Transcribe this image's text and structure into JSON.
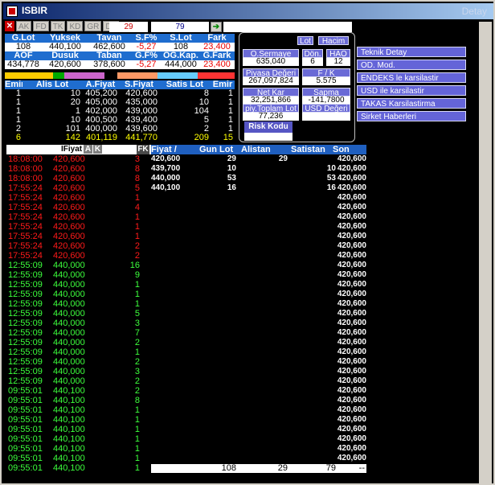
{
  "window": {
    "title": "ISBIR",
    "right_label": "Detay"
  },
  "toolbar": {
    "tabs": [
      "AK",
      "FD",
      "TK",
      "KD",
      "GR",
      "DK"
    ],
    "value_left": "29",
    "value_right": "79"
  },
  "stats": {
    "row1_headers": [
      "G.Lot",
      "Yuksek",
      "Tavan",
      "S.F%",
      "S.Lot",
      "Fark"
    ],
    "row1_values": [
      "108",
      "440,100",
      "462,600",
      "-5,27",
      "108",
      "23,400"
    ],
    "row2_headers": [
      "AOF",
      "Dusuk",
      "Taban",
      "G.F%",
      "OG.Kap.",
      "G.Fark"
    ],
    "row2_values": [
      "434,778",
      "420,600",
      "378,600",
      "-5,27",
      "444,000",
      "23,400"
    ]
  },
  "book": {
    "headers": [
      "Emir",
      "Alis Lot",
      "A.Fiyat",
      "S.Fiyat",
      "Satis Lot",
      "Emir"
    ],
    "rows": [
      [
        "1",
        "10",
        "405,200",
        "420,600",
        "8",
        "1"
      ],
      [
        "1",
        "20",
        "405,000",
        "435,000",
        "10",
        "1"
      ],
      [
        "1",
        "1",
        "402,000",
        "439,000",
        "104",
        "1"
      ],
      [
        "1",
        "10",
        "400,500",
        "439,400",
        "5",
        "1"
      ],
      [
        "2",
        "101",
        "400,000",
        "439,600",
        "2",
        "1"
      ],
      [
        "6",
        "142",
        "401,119",
        "441,770",
        "209",
        "15"
      ]
    ]
  },
  "panel": {
    "lot": "Lot",
    "hacim": "Hacim",
    "osermaye_label": "O.Sermaye",
    "osermaye_value": "635,040",
    "don_label": "Dön.",
    "don_value": "6",
    "hao_label": "HAO",
    "hao_value": "12",
    "piyasa_label": "Piyasa Değeri",
    "piyasa_value": "267,097,824",
    "fk_label": "F / K",
    "fk_value": "5.575",
    "netkar_label": "Net Kar",
    "netkar_value": "32,251,866",
    "sapma_label": "Sapma",
    "sapma_value": "-141,7800",
    "piytop_label": "piy.Toplam Lot",
    "piytop_value": "77,236",
    "usd_label": "USD Değeri",
    "risk_label": "Risk Kodu"
  },
  "menu": [
    "Teknik Detay",
    "OD. Mod.",
    "ENDEKS le karsilastir",
    "USD ile karsilastir",
    "TAKAS Karsilastirma",
    "Sirket Haberleri"
  ],
  "trades": {
    "header_label": "IFiyat",
    "btn_a": "A",
    "btn_k": "K",
    "btn_fk": "FK",
    "rows": [
      [
        "18:08:00",
        "420,600",
        "3",
        "red"
      ],
      [
        "18:08:00",
        "420,600",
        "8",
        "red"
      ],
      [
        "18:08:00",
        "420,600",
        "8",
        "red"
      ],
      [
        "17:55:24",
        "420,600",
        "5",
        "red"
      ],
      [
        "17:55:24",
        "420,600",
        "1",
        "red"
      ],
      [
        "17:55:24",
        "420,600",
        "4",
        "red"
      ],
      [
        "17:55:24",
        "420,600",
        "1",
        "red"
      ],
      [
        "17:55:24",
        "420,600",
        "1",
        "red"
      ],
      [
        "17:55:24",
        "420,600",
        "1",
        "red"
      ],
      [
        "17:55:24",
        "420,600",
        "2",
        "red"
      ],
      [
        "17:55:24",
        "420,600",
        "2",
        "red"
      ],
      [
        "12:55:09",
        "440,000",
        "16",
        "grn"
      ],
      [
        "12:55:09",
        "440,000",
        "9",
        "grn"
      ],
      [
        "12:55:09",
        "440,000",
        "1",
        "grn"
      ],
      [
        "12:55:09",
        "440,000",
        "1",
        "grn"
      ],
      [
        "12:55:09",
        "440,000",
        "1",
        "grn"
      ],
      [
        "12:55:09",
        "440,000",
        "5",
        "grn"
      ],
      [
        "12:55:09",
        "440,000",
        "3",
        "grn"
      ],
      [
        "12:55:09",
        "440,000",
        "7",
        "grn"
      ],
      [
        "12:55:09",
        "440,000",
        "2",
        "grn"
      ],
      [
        "12:55:09",
        "440,000",
        "1",
        "grn"
      ],
      [
        "12:55:09",
        "440,000",
        "2",
        "grn"
      ],
      [
        "12:55:09",
        "440,000",
        "3",
        "grn"
      ],
      [
        "12:55:09",
        "440,000",
        "2",
        "grn"
      ],
      [
        "09:55:01",
        "440,100",
        "2",
        "grn"
      ],
      [
        "09:55:01",
        "440,100",
        "8",
        "grn"
      ],
      [
        "09:55:01",
        "440,100",
        "1",
        "grn"
      ],
      [
        "09:55:01",
        "440,100",
        "1",
        "grn"
      ],
      [
        "09:55:01",
        "440,100",
        "1",
        "grn"
      ],
      [
        "09:55:01",
        "440,100",
        "1",
        "grn"
      ],
      [
        "09:55:01",
        "440,100",
        "1",
        "grn"
      ],
      [
        "09:55:01",
        "440,100",
        "1",
        "grn"
      ],
      [
        "09:55:01",
        "440,100",
        "1",
        "grn"
      ]
    ]
  },
  "depth": {
    "headers": [
      "Fiyat /",
      "Gun Lot",
      "Alistan",
      "Satistan",
      "Son"
    ],
    "rows": [
      [
        "420,600",
        "29",
        "29",
        "",
        "420,600"
      ],
      [
        "439,700",
        "10",
        "",
        "10",
        "420,600"
      ],
      [
        "440,000",
        "53",
        "",
        "53",
        "420,600"
      ],
      [
        "440,100",
        "16",
        "",
        "16",
        "420,600"
      ]
    ],
    "son_values": [
      "420,600",
      "420,600",
      "420,600",
      "420,600",
      "420,600",
      "420,600",
      "420,600",
      "420,600",
      "420,600",
      "420,600",
      "420,600",
      "420,600",
      "420,600",
      "420,600",
      "420,600",
      "420,600",
      "420,600",
      "420,600",
      "420,600",
      "420,600",
      "420,600",
      "420,600",
      "420,600",
      "420,600",
      "420,600",
      "420,600",
      "420,600",
      "420,600",
      "420,600",
      "420,600",
      "420,600",
      "420,600",
      "420,600"
    ],
    "totals": [
      "108",
      "29",
      "79",
      "--"
    ]
  }
}
